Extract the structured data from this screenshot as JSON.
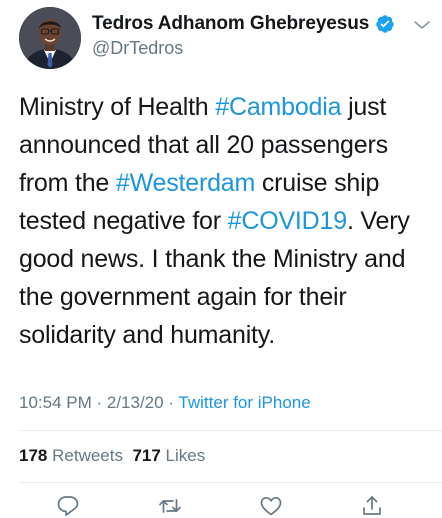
{
  "author": {
    "display_name": "Tedros Adhanom Ghebreyesus",
    "handle": "@DrTedros",
    "verified_icon": "verified-badge-icon",
    "avatar": "profile-photo"
  },
  "tweet": {
    "segments": [
      {
        "text": "Ministry of Health ",
        "type": "text"
      },
      {
        "text": "#Cambodia",
        "type": "hashtag"
      },
      {
        "text": " just announced that all 20 passengers from the ",
        "type": "text"
      },
      {
        "text": "#Westerdam",
        "type": "hashtag"
      },
      {
        "text": " cruise ship tested negative for ",
        "type": "text"
      },
      {
        "text": "#COVID19",
        "type": "hashtag"
      },
      {
        "text": ". Very good news. I thank the Ministry and the government again for their solidarity and humanity.",
        "type": "text"
      }
    ]
  },
  "meta": {
    "time": "10:54 PM",
    "separator1": " · ",
    "date": "2/13/20",
    "separator2": " · ",
    "source": "Twitter for iPhone"
  },
  "stats": {
    "retweets_count": "178",
    "retweets_label": "Retweets",
    "likes_count": "717",
    "likes_label": "Likes"
  },
  "actions": {
    "reply_icon": "reply-icon",
    "retweet_icon": "retweet-icon",
    "like_icon": "heart-icon",
    "share_icon": "share-icon"
  },
  "colors": {
    "text": "#14171a",
    "secondary": "#657786",
    "link": "#1b95e0",
    "verified": "#1da1f2",
    "divider": "#e6ecf0"
  }
}
